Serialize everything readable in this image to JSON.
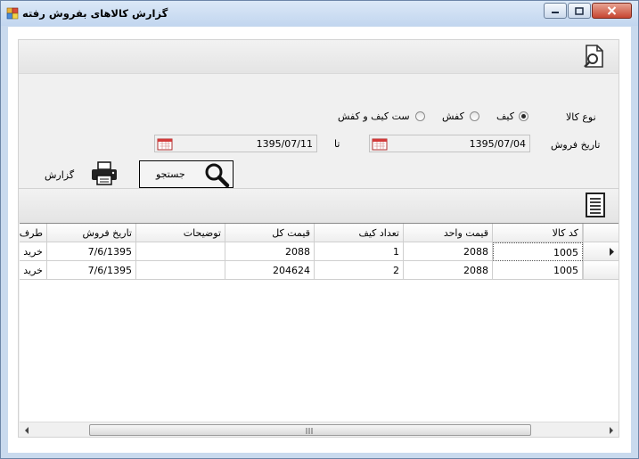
{
  "window": {
    "title": "گزارش کالاهای بفروش رفته"
  },
  "filters": {
    "product_type_label": "نوع کالا",
    "options": [
      {
        "label": "کیف",
        "checked": true
      },
      {
        "label": "کفش",
        "checked": false
      },
      {
        "label": "ست کیف و کفش",
        "checked": false
      }
    ],
    "sale_date_label": "تاریخ فروش",
    "to_label": "تا",
    "date_from": "1395/07/04",
    "date_to": "1395/07/11",
    "search_label": "جستجو",
    "report_label": "گزارش"
  },
  "grid": {
    "columns": [
      "کد کالا",
      "قیمت واحد",
      "تعداد کیف",
      "قیمت کل",
      "توضیحات",
      "تاریخ فروش",
      "طرف"
    ],
    "rows": [
      [
        "1005",
        "2088",
        "1",
        "2088",
        "",
        "7/6/1395",
        "خرید"
      ],
      [
        "1005",
        "2088",
        "2",
        "204624",
        "",
        "7/6/1395",
        "خرید"
      ]
    ]
  },
  "icons": {
    "app": "app-icon",
    "preview": "document-search-icon",
    "print": "printer-icon",
    "search": "magnifier-icon",
    "list": "document-list-icon"
  }
}
